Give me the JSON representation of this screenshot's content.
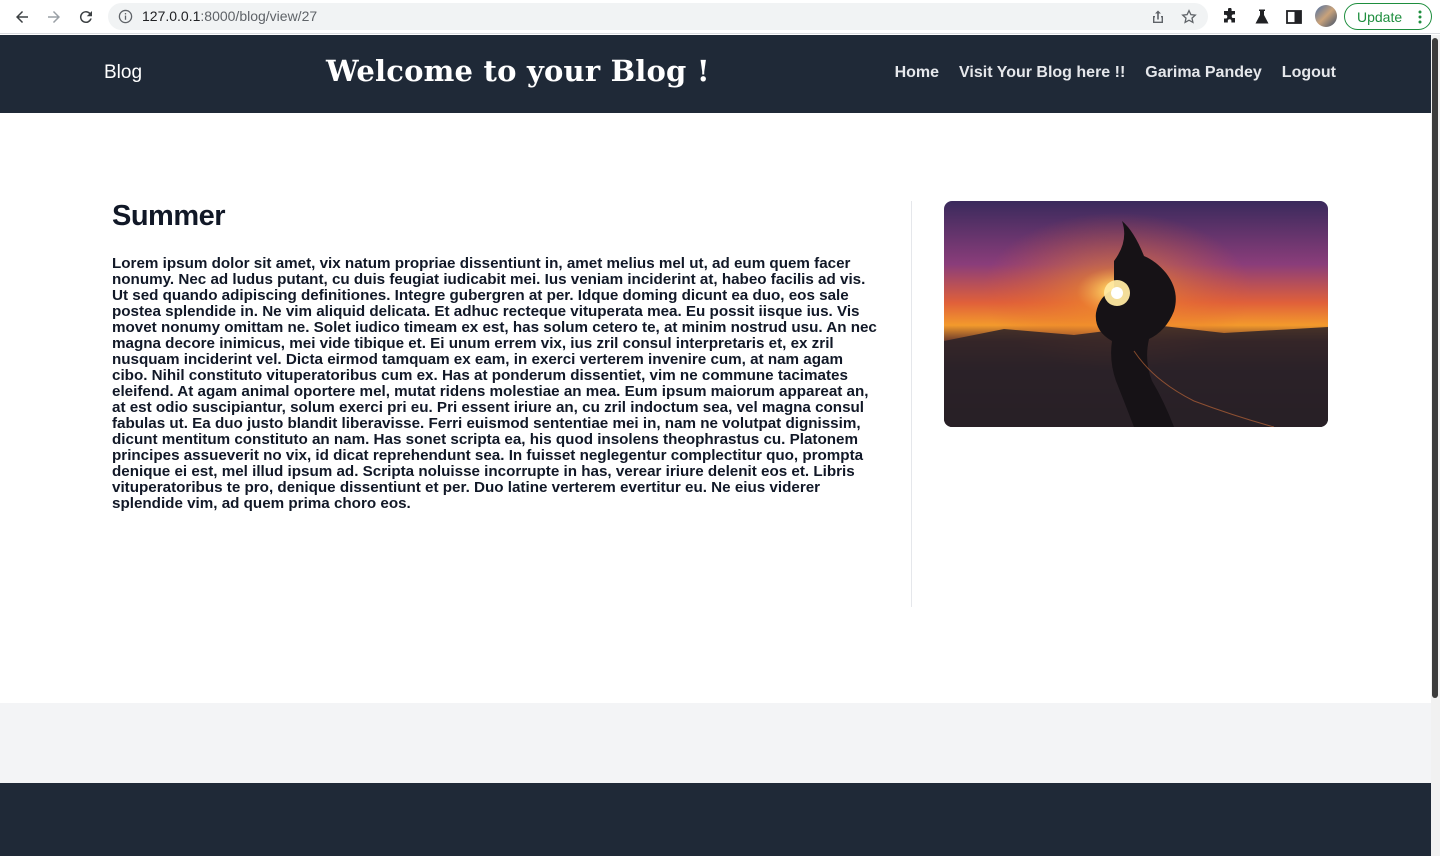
{
  "browser": {
    "url_host": "127.0.0.1",
    "url_rest": ":8000/blog/view/27",
    "update_label": "Update"
  },
  "header": {
    "brand": "Blog",
    "welcome": "Welcome to your Blog !",
    "nav": [
      {
        "label": "Home"
      },
      {
        "label": "Visit Your Blog here !!"
      },
      {
        "label": "Garima Pandey"
      },
      {
        "label": "Logout"
      }
    ]
  },
  "post": {
    "title": "Summer",
    "body": "Lorem ipsum dolor sit amet, vix natum propriae dissentiunt in, amet melius mel ut, ad eum quem facer nonumy. Nec ad ludus putant, cu duis feugiat iudicabit mei. Ius veniam inciderint at, habeo facilis ad vis. Ut sed quando adipiscing definitiones. Integre gubergren at per. Idque doming dicunt ea duo, eos sale postea splendide in. Ne vim aliquid delicata. Et adhuc recteque vituperata mea. Eu possit iisque ius. Vis movet nonumy omittam ne. Solet iudico timeam ex est, has solum cetero te, at minim nostrud usu. An nec magna decore inimicus, mei vide tibique et. Ei unum errem vix, ius zril consul interpretaris et, ex zril nusquam inciderint vel. Dicta eirmod tamquam ex eam, in exerci verterem invenire cum, at nam agam cibo. Nihil constituto vituperatoribus cum ex. Has at ponderum dissentiet, vim ne commune tacimates eleifend. At agam animal oportere mel, mutat ridens molestiae an mea. Eum ipsum maiorum appareat an, at est odio suscipiantur, solum exerci pri eu. Pri essent iriure an, cu zril indoctum sea, vel magna consul fabulas ut. Ea duo justo blandit liberavisse. Ferri euismod sententiae mei in, nam ne volutpat dignissim, dicunt mentitum constituto an nam. Has sonet scripta ea, his quod insolens theophrastus cu. Platonem principes assueverit no vix, id dicat reprehendunt sea. In fuisset neglegentur complectitur quo, prompta denique ei est, mel illud ipsum ad. Scripta noluisse incorrupte in has, verear iriure delenit eos et. Libris vituperatoribus te pro, denique dissentiunt et per. Duo latine verterem evertitur eu. Ne eius viderer splendide vim, ad quem prima choro eos."
  },
  "icons": {
    "back": "arrow-left-icon",
    "forward": "arrow-right-icon",
    "reload": "reload-icon",
    "site_info": "info-icon",
    "share": "share-icon",
    "bookmark": "star-icon",
    "extensions": "puzzle-icon",
    "labs": "flask-icon",
    "side_panel": "side-panel-icon",
    "menu": "kebab-menu-icon"
  },
  "colors": {
    "header_bg": "#1f2937",
    "band_bg": "#f3f4f6",
    "update_green": "#1e8e3e"
  }
}
